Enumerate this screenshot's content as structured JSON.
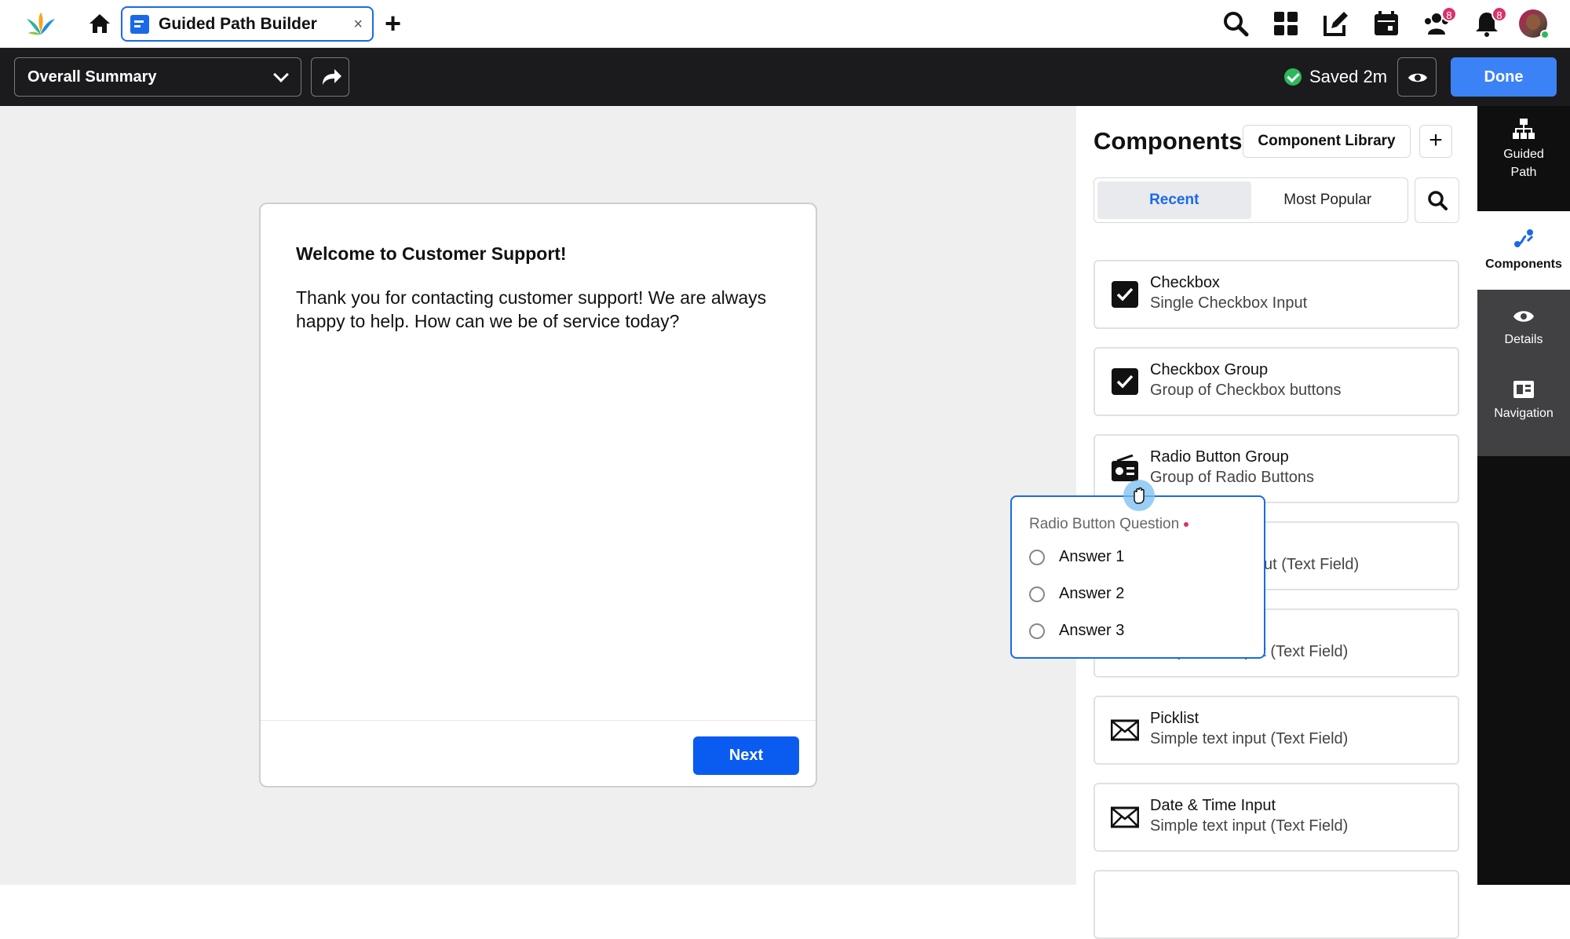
{
  "app": {
    "tab_title": "Guided Path Builder",
    "tab_close": "×",
    "new_tab": "+",
    "notifications_badge": "8",
    "people_badge": "8"
  },
  "toolbar": {
    "summary_select": "Overall Summary",
    "saved_text": "Saved 2m",
    "done_label": "Done"
  },
  "card": {
    "title": "Welcome to Customer Support!",
    "body": "Thank you for contacting customer support! We are always happy to help. How can we be of service today?",
    "next_label": "Next"
  },
  "panel": {
    "title": "Components",
    "library_label": "Component Library",
    "add_label": "+",
    "tabs": [
      "Recent",
      "Most Popular"
    ],
    "active_tab": "Recent",
    "items": [
      {
        "name": "Checkbox",
        "desc": "Single Checkbox Input",
        "icon": "checkbox-icon"
      },
      {
        "name": "Checkbox Group",
        "desc": "Group of Checkbox buttons",
        "icon": "checkbox-icon"
      },
      {
        "name": "Radio Button Group",
        "desc": "Group of Radio Buttons",
        "icon": "radio-icon"
      },
      {
        "name": "",
        "desc": "ut (Text Field)",
        "icon": ""
      },
      {
        "name": "",
        "desc": "Simple text input (Text Field)",
        "icon": ""
      },
      {
        "name": "Picklist",
        "desc": "Simple text input (Text Field)",
        "icon": "envelope-icon"
      },
      {
        "name": "Date & Time Input",
        "desc": "Simple text input (Text Field)",
        "icon": "envelope-icon"
      }
    ]
  },
  "rail": {
    "guided_path": "Guided Path",
    "components": "Components",
    "details": "Details",
    "navigation": "Navigation"
  },
  "drag_preview": {
    "label": "Radio Button Question",
    "answers": [
      "Answer 1",
      "Answer 2",
      "Answer 3"
    ]
  },
  "colors": {
    "accent": "#1a6ae6",
    "done": "#3b82f6",
    "next": "#0a5cf0",
    "saved": "#2eb85c",
    "badge": "#d6336c"
  }
}
